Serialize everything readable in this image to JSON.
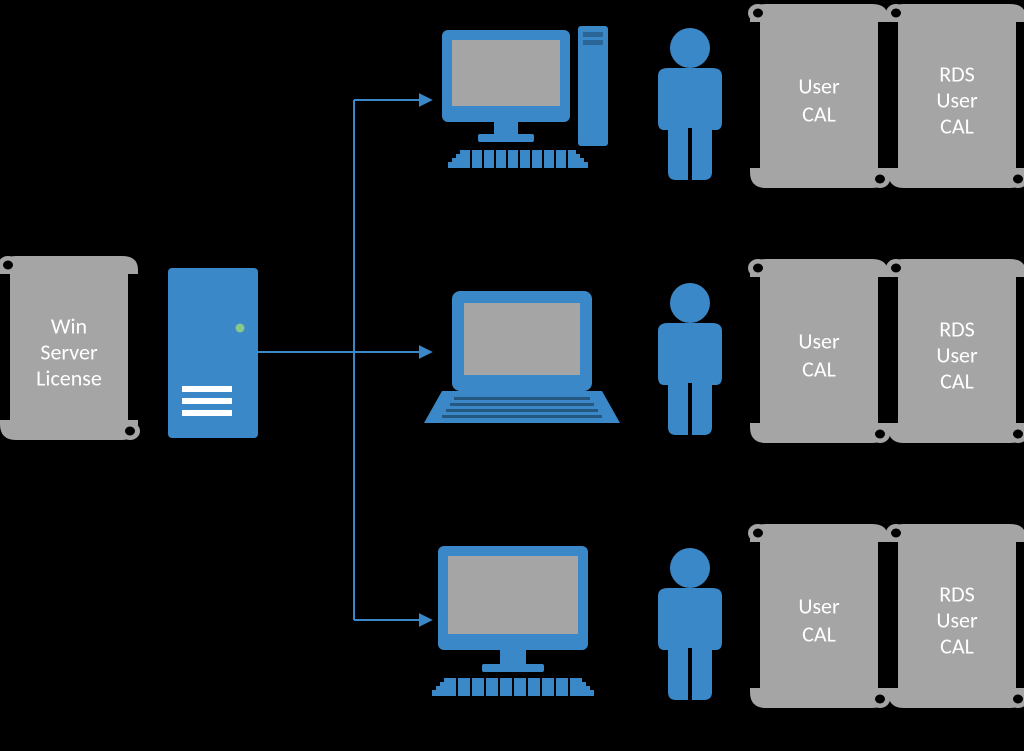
{
  "colors": {
    "blue": "#3A88C8",
    "grey": "#A5A5A5",
    "white": "#FFFFFF",
    "screen_grey": "#A5A5A5"
  },
  "server_license": {
    "line1": "Win",
    "line2": "Server",
    "line3": "License"
  },
  "rows": [
    {
      "cal": {
        "line1": "User",
        "line2": "CAL"
      },
      "rds": {
        "line1": "RDS",
        "line2": "User",
        "line3": "CAL"
      },
      "client": "desktop"
    },
    {
      "cal": {
        "line1": "User",
        "line2": "CAL"
      },
      "rds": {
        "line1": "RDS",
        "line2": "User",
        "line3": "CAL"
      },
      "client": "laptop"
    },
    {
      "cal": {
        "line1": "User",
        "line2": "CAL"
      },
      "rds": {
        "line1": "RDS",
        "line2": "User",
        "line3": "CAL"
      },
      "client": "monitor"
    }
  ],
  "layout": {
    "rows_y": [
      100,
      355,
      620
    ]
  }
}
